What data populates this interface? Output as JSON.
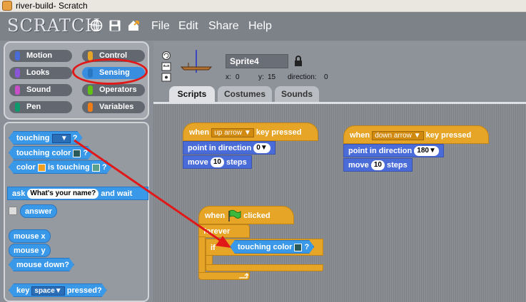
{
  "window": {
    "title": "river-build- Scratch"
  },
  "app": {
    "logo": "SCRATCH"
  },
  "menu": [
    "File",
    "Edit",
    "Share",
    "Help"
  ],
  "categories": [
    {
      "label": "Motion",
      "color": "#4a6cd8"
    },
    {
      "label": "Control",
      "color": "#e6a526"
    },
    {
      "label": "Looks",
      "color": "#8a55d7"
    },
    {
      "label": "Sensing",
      "color": "#3a98e8",
      "selected": true
    },
    {
      "label": "Sound",
      "color": "#c94fc9"
    },
    {
      "label": "Operators",
      "color": "#62c213"
    },
    {
      "label": "Pen",
      "color": "#0e9a6c"
    },
    {
      "label": "Variables",
      "color": "#ee7d16"
    }
  ],
  "palette": {
    "touching": "touching",
    "touching_end": "?",
    "touching_color": "touching color",
    "color_label": "color",
    "is_touching": "is touching",
    "ask": "ask",
    "ask_default": "What's your name?",
    "and_wait": "and wait",
    "answer": "answer",
    "mouse_x": "mouse x",
    "mouse_y": "mouse y",
    "mouse_down": "mouse down?",
    "key": "key",
    "key_value": "space",
    "pressed": "pressed?"
  },
  "sprite": {
    "name": "Sprite4",
    "x_label": "x:",
    "x": "0",
    "y_label": "y:",
    "y": "15",
    "direction_label": "direction:",
    "direction": "0"
  },
  "tabs": [
    "Scripts",
    "Costumes",
    "Sounds"
  ],
  "scripts": {
    "script1": {
      "when": "when",
      "key": "up arrow",
      "key_pressed": "key pressed",
      "point": "point in direction",
      "dir": "0",
      "move": "move",
      "steps_val": "10",
      "steps": "steps"
    },
    "script2": {
      "when": "when",
      "key": "down arrow",
      "key_pressed": "key pressed",
      "point": "point in direction",
      "dir": "180",
      "move": "move",
      "steps_val": "10",
      "steps": "steps"
    },
    "script3": {
      "when": "when",
      "clicked": "clicked",
      "forever": "forever",
      "if": "if",
      "touching_color": "touching color",
      "q": "?"
    }
  },
  "colors": {
    "annotation_red": "#e01818",
    "sensing": "#3a98e8",
    "control": "#e6a526",
    "motion": "#4a6cd8"
  }
}
